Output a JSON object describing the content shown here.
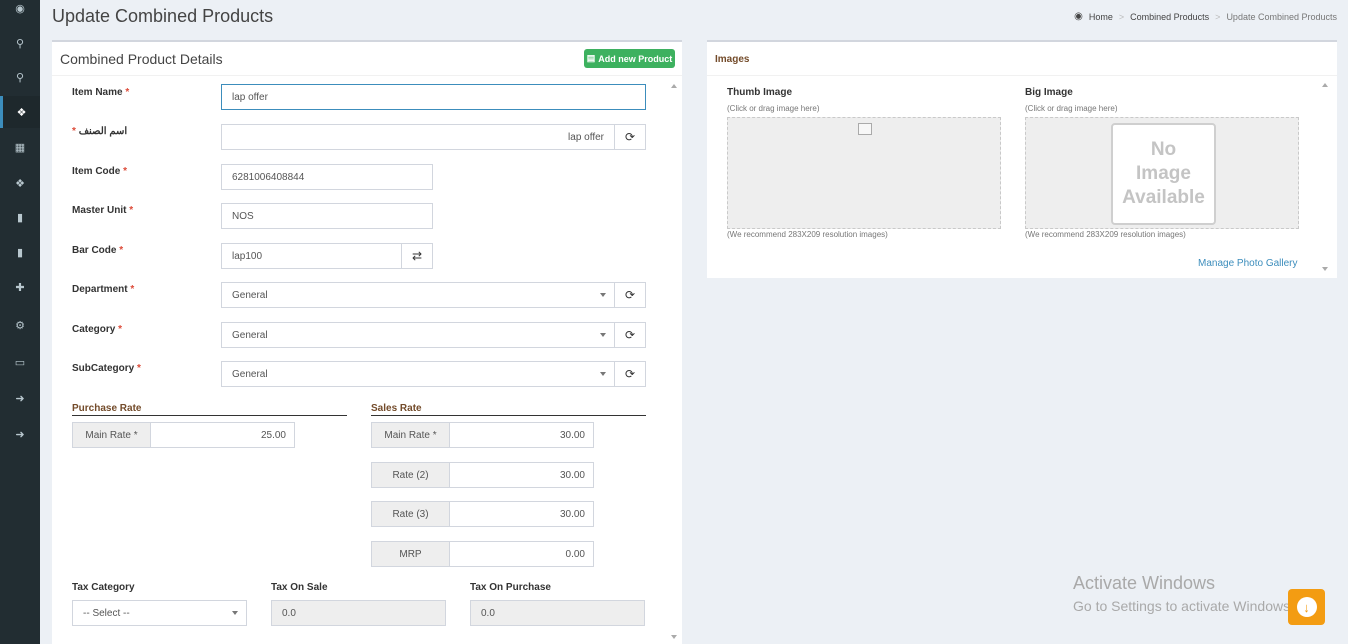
{
  "page": {
    "title": "Update Combined Products",
    "breadcrumb": [
      "Home",
      "Combined Products",
      "Update Combined Products"
    ]
  },
  "sidebar": {
    "items": [
      {
        "icon": "dashboard-icon",
        "glyph": "◉"
      },
      {
        "icon": "search-icon",
        "glyph": "⚲"
      },
      {
        "icon": "search-icon",
        "glyph": "⚲"
      },
      {
        "icon": "cubes-icon",
        "glyph": "❖"
      },
      {
        "icon": "calculator-icon",
        "glyph": "▦"
      },
      {
        "icon": "cubes-icon",
        "glyph": "❖"
      },
      {
        "icon": "info-icon",
        "glyph": "▮"
      },
      {
        "icon": "info-icon",
        "glyph": "▮"
      },
      {
        "icon": "puzzle-icon",
        "glyph": "✚"
      },
      {
        "icon": "gears-icon",
        "glyph": "⚙"
      },
      {
        "icon": "laptop-icon",
        "glyph": "▭"
      },
      {
        "icon": "sign-out-icon",
        "glyph": "➜"
      },
      {
        "icon": "sign-out-icon",
        "glyph": "➜"
      }
    ]
  },
  "details": {
    "title": "Combined Product Details",
    "add_button": "Add new Product",
    "item_name": {
      "label": "Item Name",
      "value": "lap offer"
    },
    "item_name_ar": {
      "label": "اسم الصنف",
      "value": "lap offer"
    },
    "item_code": {
      "label": "Item Code",
      "value": "6281006408844"
    },
    "master_unit": {
      "label": "Master Unit",
      "value": "NOS"
    },
    "bar_code": {
      "label": "Bar Code",
      "value": "lap100"
    },
    "department": {
      "label": "Department",
      "value": "General"
    },
    "category": {
      "label": "Category",
      "value": "General"
    },
    "subcategory": {
      "label": "SubCategory",
      "value": "General"
    },
    "required_mark": "*",
    "purchase_rate": {
      "title": "Purchase Rate",
      "main_rate_label": "Main Rate *",
      "main_rate": "25.00"
    },
    "sales_rate": {
      "title": "Sales Rate",
      "main_rate_label": "Main Rate *",
      "main_rate": "30.00",
      "rate2_label": "Rate (2)",
      "rate2": "30.00",
      "rate3_label": "Rate (3)",
      "rate3": "30.00",
      "mrp_label": "MRP",
      "mrp": "0.00"
    },
    "tax_category": {
      "label": "Tax Category",
      "value": "-- Select --"
    },
    "tax_on_sale": {
      "label": "Tax On Sale",
      "value": "0.0"
    },
    "tax_on_purchase": {
      "label": "Tax On Purchase",
      "value": "0.0"
    }
  },
  "images": {
    "title": "Images",
    "thumb": {
      "label": "Thumb Image",
      "hint": "(Click or drag image here)",
      "recommend": "(We recommend 283X209 resolution images)"
    },
    "big": {
      "label": "Big Image",
      "hint": "(Click or drag image here)",
      "recommend": "(We recommend 283X209 resolution images)",
      "placeholder_lines": [
        "No",
        "Image",
        "Available"
      ]
    },
    "gallery_link": "Manage Photo Gallery"
  },
  "watermark": {
    "line1": "Activate Windows",
    "line2": "Go to Settings to activate Windows."
  },
  "colors": {
    "sidebar_bg": "#222d32",
    "accent": "#3c8dbc",
    "add_button": "#3db15f",
    "required": "#dd4b39",
    "section_title": "#734b2a",
    "fab": "#f39c12"
  }
}
